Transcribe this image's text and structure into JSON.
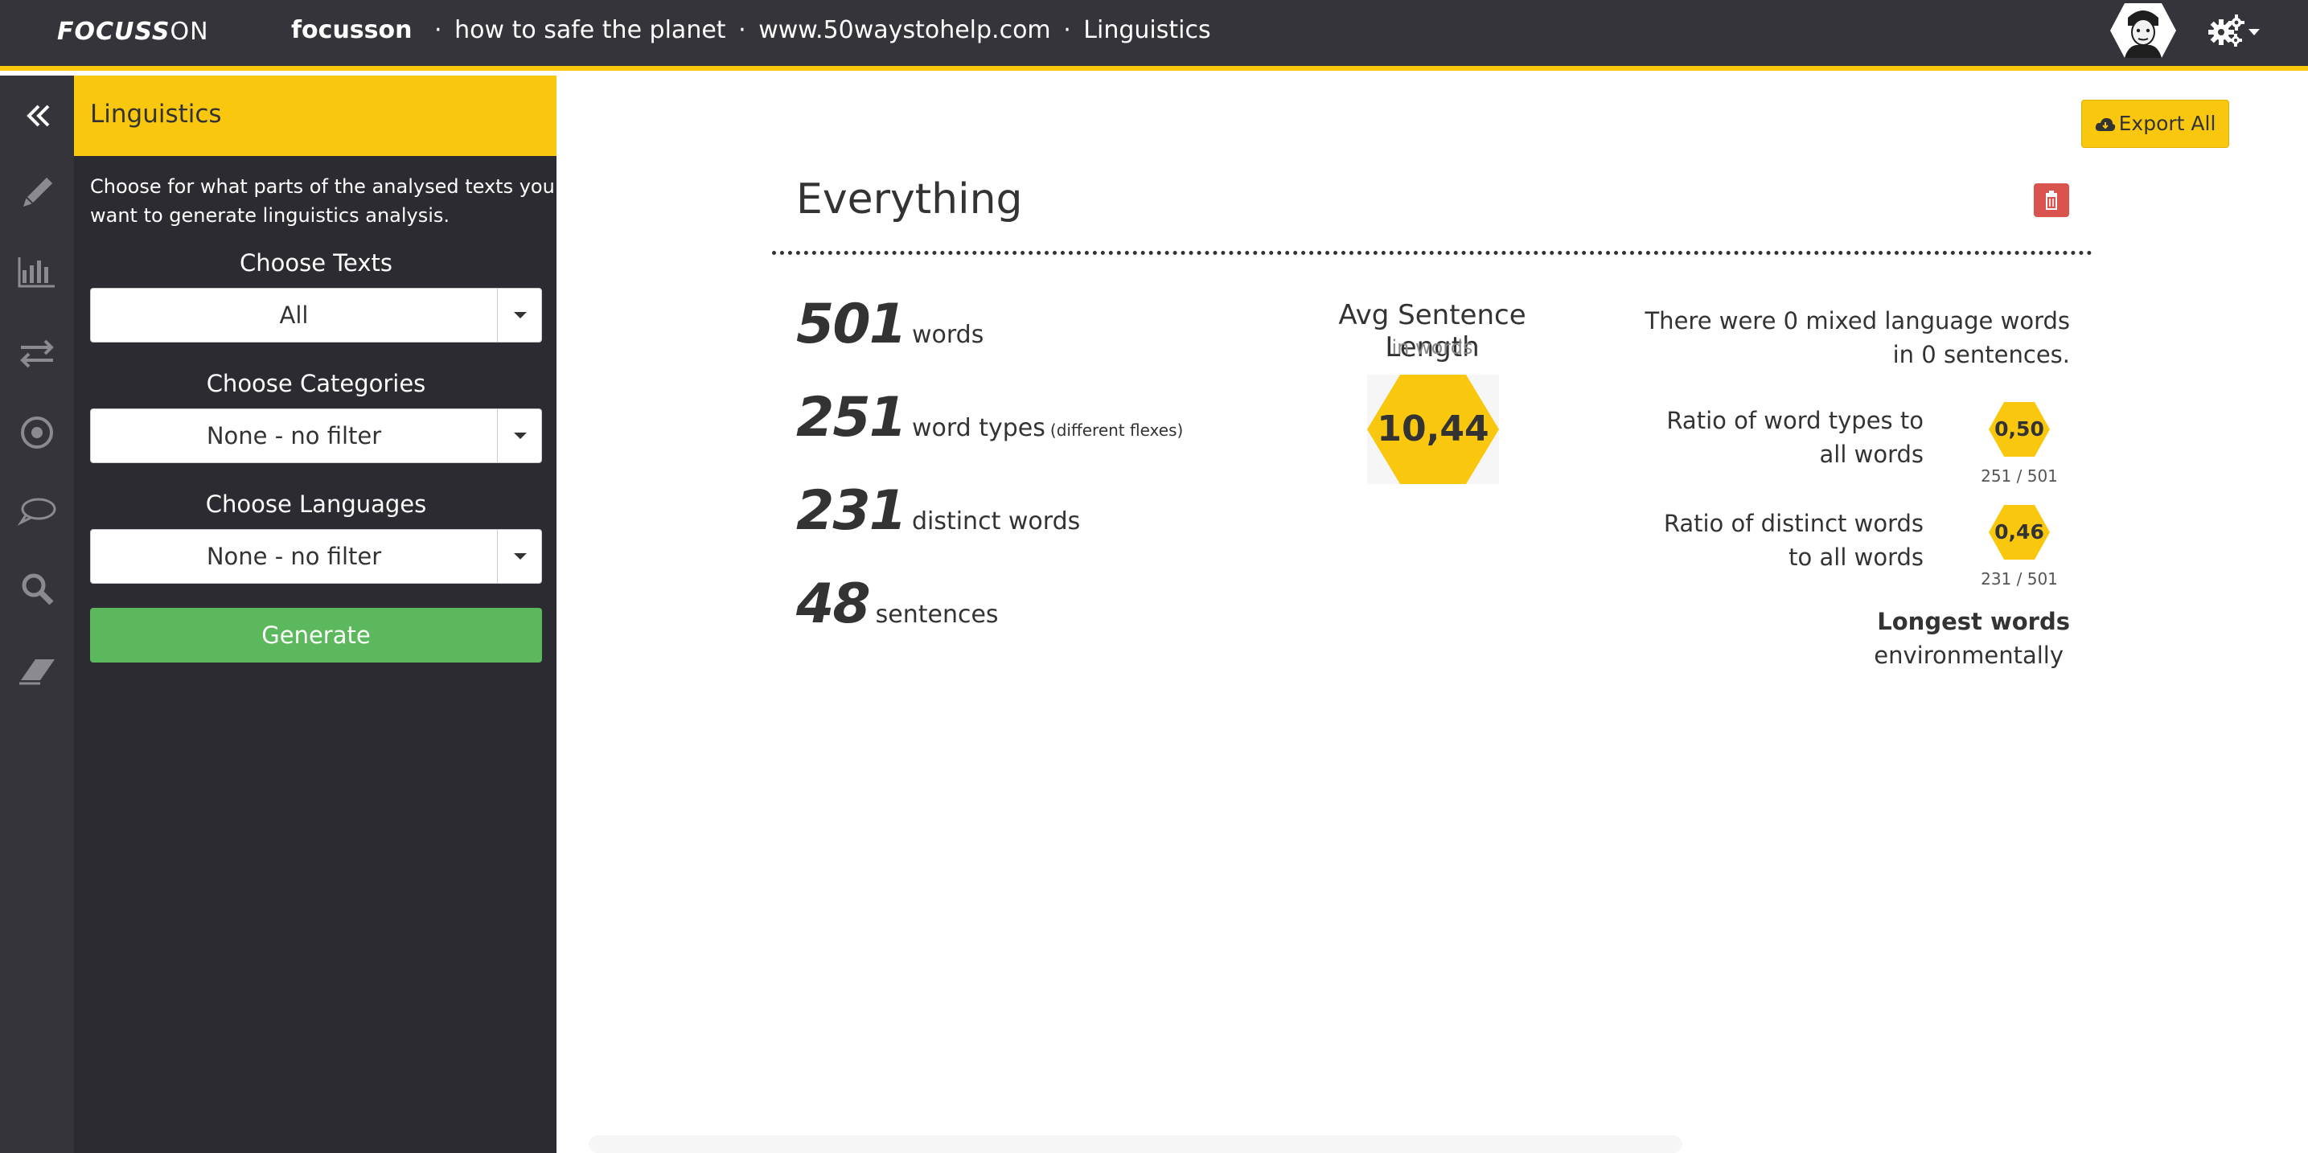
{
  "topbar": {
    "logo_bold": "FOCUSS",
    "logo_light": "ON",
    "breadcrumb": {
      "app": "focusson",
      "sep": "·",
      "project": "how to safe the planet",
      "source": "www.50waystohelp.com",
      "page": "Linguistics"
    },
    "icons": [
      "avatar",
      "settings-gear-icon",
      "caret-down-icon"
    ]
  },
  "rail": {
    "items": [
      "collapse-chevrons-icon",
      "pencil-icon",
      "bar-chart-icon",
      "arrows-exchange-icon",
      "target-icon",
      "speech-bubble-icon",
      "search-icon",
      "eraser-icon"
    ]
  },
  "panel": {
    "title": "Linguistics",
    "description": "Choose for what parts of the analysed texts you want to generate linguistics analysis.",
    "texts_label": "Choose Texts",
    "texts_value": "All",
    "categories_label": "Choose Categories",
    "categories_value": "None - no filter",
    "languages_label": "Choose Languages",
    "languages_value": "None - no filter",
    "generate_label": "Generate"
  },
  "main": {
    "export_label": "Export All",
    "section_title": "Everything",
    "stats": [
      {
        "value": "501",
        "label": "words",
        "note": ""
      },
      {
        "value": "251",
        "label": "word types",
        "note": "(different flexes)"
      },
      {
        "value": "231",
        "label": "distinct words",
        "note": ""
      },
      {
        "value": "48",
        "label": "sentences",
        "note": ""
      }
    ],
    "avg": {
      "title": "Avg Sentence Length",
      "subtitle": "in words",
      "value": "10,44"
    },
    "mixed": {
      "line1": "There were 0 mixed language words",
      "line2": "in 0 sentences."
    },
    "ratios": [
      {
        "line1": "Ratio of word types to",
        "line2": "all words",
        "value": "0,50",
        "fraction": "251 / 501"
      },
      {
        "line1": "Ratio of distinct words",
        "line2": "to all words",
        "value": "0,46",
        "fraction": "231 / 501"
      }
    ],
    "longest": {
      "title": "Longest words",
      "word": "environmentally"
    }
  },
  "colors": {
    "accent": "#f9c80e",
    "dark": "#34343a",
    "panel": "#2b2b31",
    "success": "#5cb85c",
    "danger": "#d9534f"
  }
}
